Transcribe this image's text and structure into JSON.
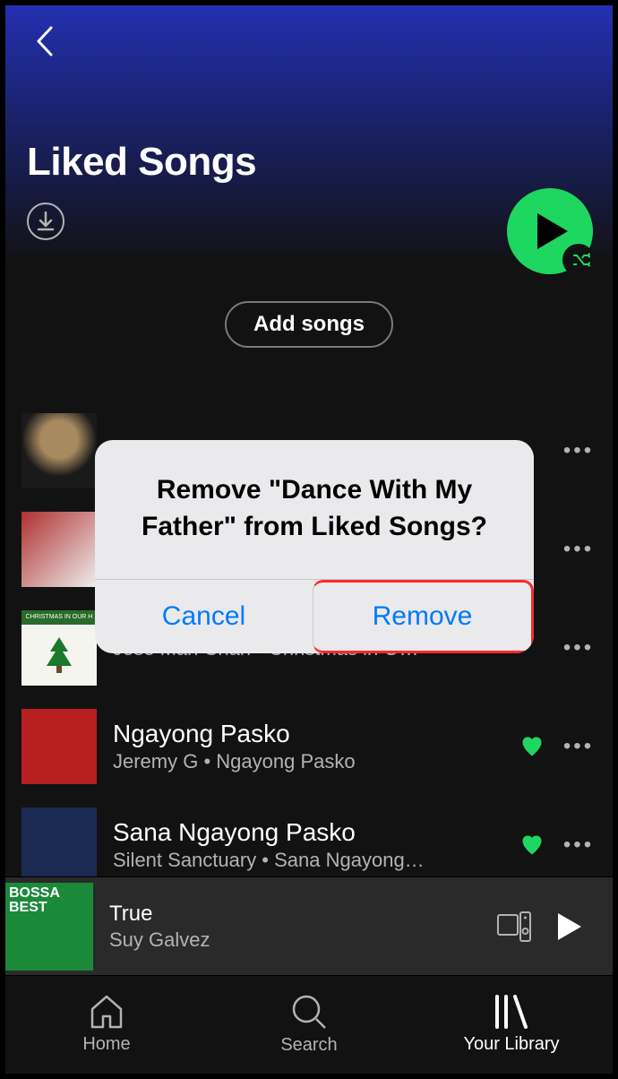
{
  "header": {
    "title": "Liked Songs"
  },
  "add_songs_label": "Add songs",
  "tracks": [
    {
      "title": "Dance With My Father",
      "subtitle": "",
      "liked": false
    },
    {
      "title": "",
      "subtitle": "",
      "liked": false
    },
    {
      "title": "",
      "subtitle": "Jose Mari Chan • Christmas in O…",
      "liked": false
    },
    {
      "title": "Ngayong Pasko",
      "subtitle": "Jeremy G • Ngayong Pasko",
      "liked": true
    },
    {
      "title": "Sana Ngayong Pasko",
      "subtitle": "Silent Sanctuary • Sana Ngayong…",
      "liked": true
    }
  ],
  "now_playing": {
    "title": "True",
    "artist": "Suy Galvez"
  },
  "tabs": {
    "home": "Home",
    "search": "Search",
    "library": "Your Library"
  },
  "dialog": {
    "message": "Remove \"Dance With My Father\" from Liked Songs?",
    "cancel": "Cancel",
    "confirm": "Remove"
  }
}
